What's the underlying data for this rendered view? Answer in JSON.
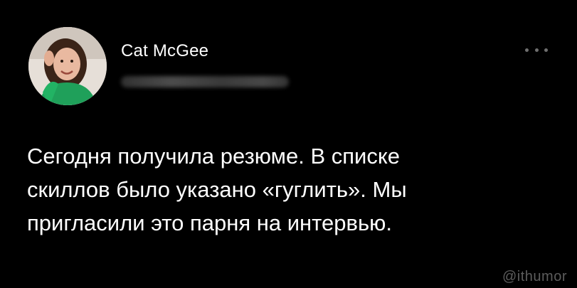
{
  "author": {
    "name": "Cat McGee",
    "handle": ""
  },
  "tweet": {
    "text": "Сегодня получила резюме. В списке\nскиллов было указано «гуглить». Мы\nпригласили это парня на интервью."
  },
  "watermark": "@ithumor",
  "icons": {
    "more": "more-horizontal-icon",
    "avatar": "profile-photo"
  },
  "colors": {
    "background": "#000000",
    "text": "#ffffff",
    "muted": "#6f6f6f",
    "avatar_shirt": "#1fa05a"
  }
}
